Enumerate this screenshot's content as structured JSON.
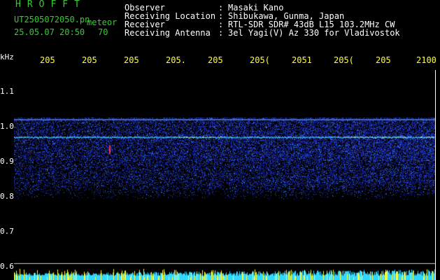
{
  "header": {
    "app_title": "HROFFT",
    "filename": "UT2505072050.pn",
    "file_tag": "meteor",
    "datetime": "25.05.07 20:50",
    "count": "70",
    "info": [
      {
        "label": "Observer",
        "sep": ":",
        "value": "Masaki Kano"
      },
      {
        "label": "Receiving Location",
        "sep": ":",
        "value": "Shibukawa, Gunma, Japan"
      },
      {
        "label": "Receiver",
        "sep": ":",
        "value": "RTL-SDR SDR# 43dB L15 103.2MHz CW"
      },
      {
        "label": "Receiving Antenna",
        "sep": ":",
        "value": "3el Yagi(V) Az 330 for Vladivostok"
      }
    ]
  },
  "axis": {
    "y_unit": "kHz",
    "y_ticks": [
      "1.1",
      "1.0",
      "0.9",
      "0.8",
      "0.7",
      "0.6"
    ],
    "x_ticks": [
      "205",
      "205",
      "205",
      "205.",
      "205",
      "205(",
      "2051",
      "205(",
      "205",
      "2100"
    ]
  },
  "colors": {
    "background": "#000000",
    "text": "#ffffff",
    "title_green": "#33cc33",
    "tick_yellow": "#ffff33",
    "noise_blue": "#1f2aa8",
    "signal_cyan": "#40e0ff",
    "meter_yellow": "#ffff00"
  }
}
